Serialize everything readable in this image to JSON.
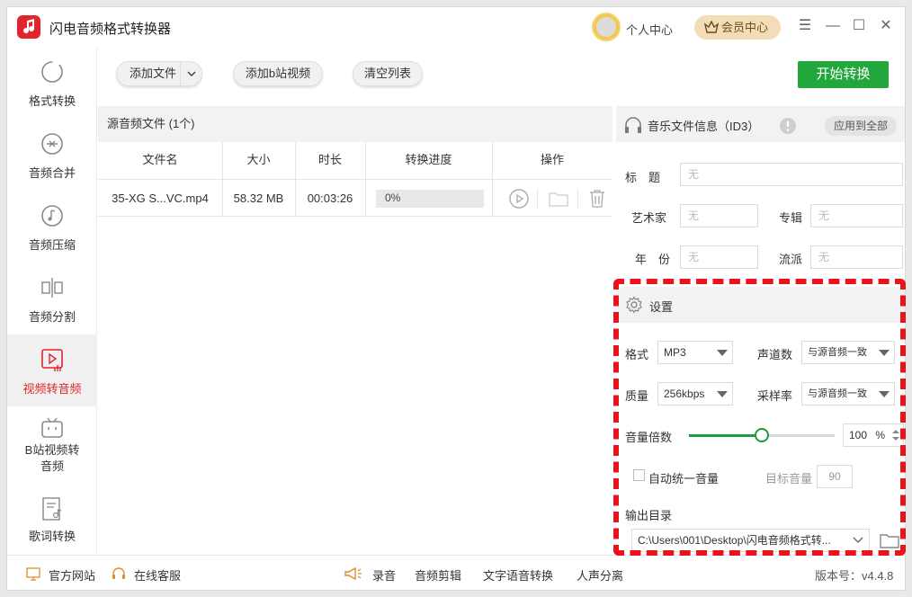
{
  "app": {
    "title": "闪电音频格式转换器",
    "personal_center": "个人中心",
    "vip_center": "会员中心"
  },
  "window_controls": {
    "menu": "☰",
    "minimize": "—",
    "maximize": "☐",
    "close": "✕"
  },
  "sidebar": {
    "items": [
      {
        "label": "格式转换",
        "icon": "refresh-circle-icon",
        "active": false
      },
      {
        "label": "音频合并",
        "icon": "merge-icon",
        "active": false
      },
      {
        "label": "音频压缩",
        "icon": "music-note-icon",
        "active": false
      },
      {
        "label": "音频分割",
        "icon": "split-icon",
        "active": false
      },
      {
        "label": "视频转音频",
        "icon": "video-play-icon",
        "active": true
      },
      {
        "label": "B站视频转音频",
        "label_line1": "B站视频转",
        "label_line2": "音频",
        "icon": "bilibili-tv-icon",
        "active": false
      },
      {
        "label": "歌词转换",
        "icon": "lyrics-file-icon",
        "active": false
      }
    ]
  },
  "toolbar": {
    "add_file": "添加文件",
    "add_bilibili": "添加b站视频",
    "clear_list": "清空列表",
    "start": "开始转换"
  },
  "file_panel": {
    "header": "源音频文件 (1个)",
    "columns": [
      "文件名",
      "大小",
      "时长",
      "转换进度",
      "操作"
    ],
    "rows": [
      {
        "name": "35-XG S...VC.mp4",
        "size": "58.32 MB",
        "duration": "00:03:26",
        "progress_text": "0%",
        "progress_fraction": 0
      }
    ]
  },
  "id3": {
    "header": "音乐文件信息（ID3）",
    "apply_all": "应用到全部",
    "title_label": "标　题",
    "title_value": "无",
    "artist_label": "艺术家",
    "artist_value": "无",
    "album_label": "专辑",
    "album_value": "无",
    "year_label": "年　份",
    "year_value": "无",
    "genre_label": "流派",
    "genre_value": "无"
  },
  "settings": {
    "header": "设置",
    "format_label": "格式",
    "format_value": "MP3",
    "channels_label": "声道数",
    "channels_value": "与源音频一致",
    "quality_label": "质量",
    "quality_value": "256kbps",
    "samplerate_label": "采样率",
    "samplerate_value": "与源音频一致",
    "volume_label": "音量倍数",
    "volume_value": "100",
    "volume_unit": "%",
    "volume_fraction": 0.5,
    "auto_volume_label": "自动统一音量",
    "auto_volume_checked": false,
    "target_volume_label": "目标音量",
    "target_volume_value": "90",
    "output_dir_label": "输出目录",
    "output_dir_value": "C:\\Users\\001\\Desktop\\闪电音频格式转..."
  },
  "footer": {
    "official_site": "官方网站",
    "online_service": "在线客服",
    "record": "录音",
    "audio_edit": "音频剪辑",
    "tts": "文字语音转换",
    "vocal_separation": "人声分离",
    "version": "版本号：v4.4.8"
  },
  "colors": {
    "accent_red": "#e0262c",
    "start_green": "#22a73c",
    "highlight_dash": "#e8141c"
  }
}
